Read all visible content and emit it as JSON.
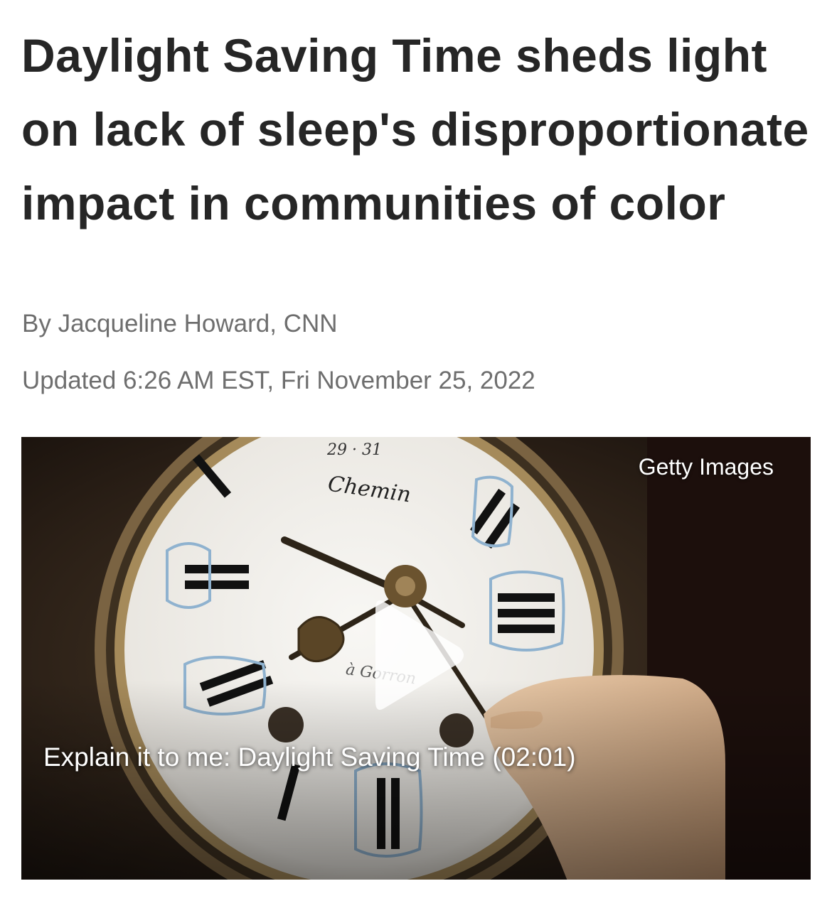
{
  "article": {
    "headline": "Daylight Saving Time sheds light on lack of sleep's disproportionate impact in communities of color",
    "byline": "By Jacqueline Howard, CNN",
    "updated": "Updated 6:26 AM EST, Fri November 25, 2022"
  },
  "video": {
    "credit": "Getty Images",
    "caption": "Explain it to me: Daylight Saving Time (02:01)",
    "play_icon": "play-icon",
    "clock_dial_text": [
      "29 · 31",
      "Chemin",
      "à Gorron"
    ]
  },
  "colors": {
    "headline": "#262626",
    "meta": "#6e6e6e",
    "overlay_text": "#ffffff"
  }
}
